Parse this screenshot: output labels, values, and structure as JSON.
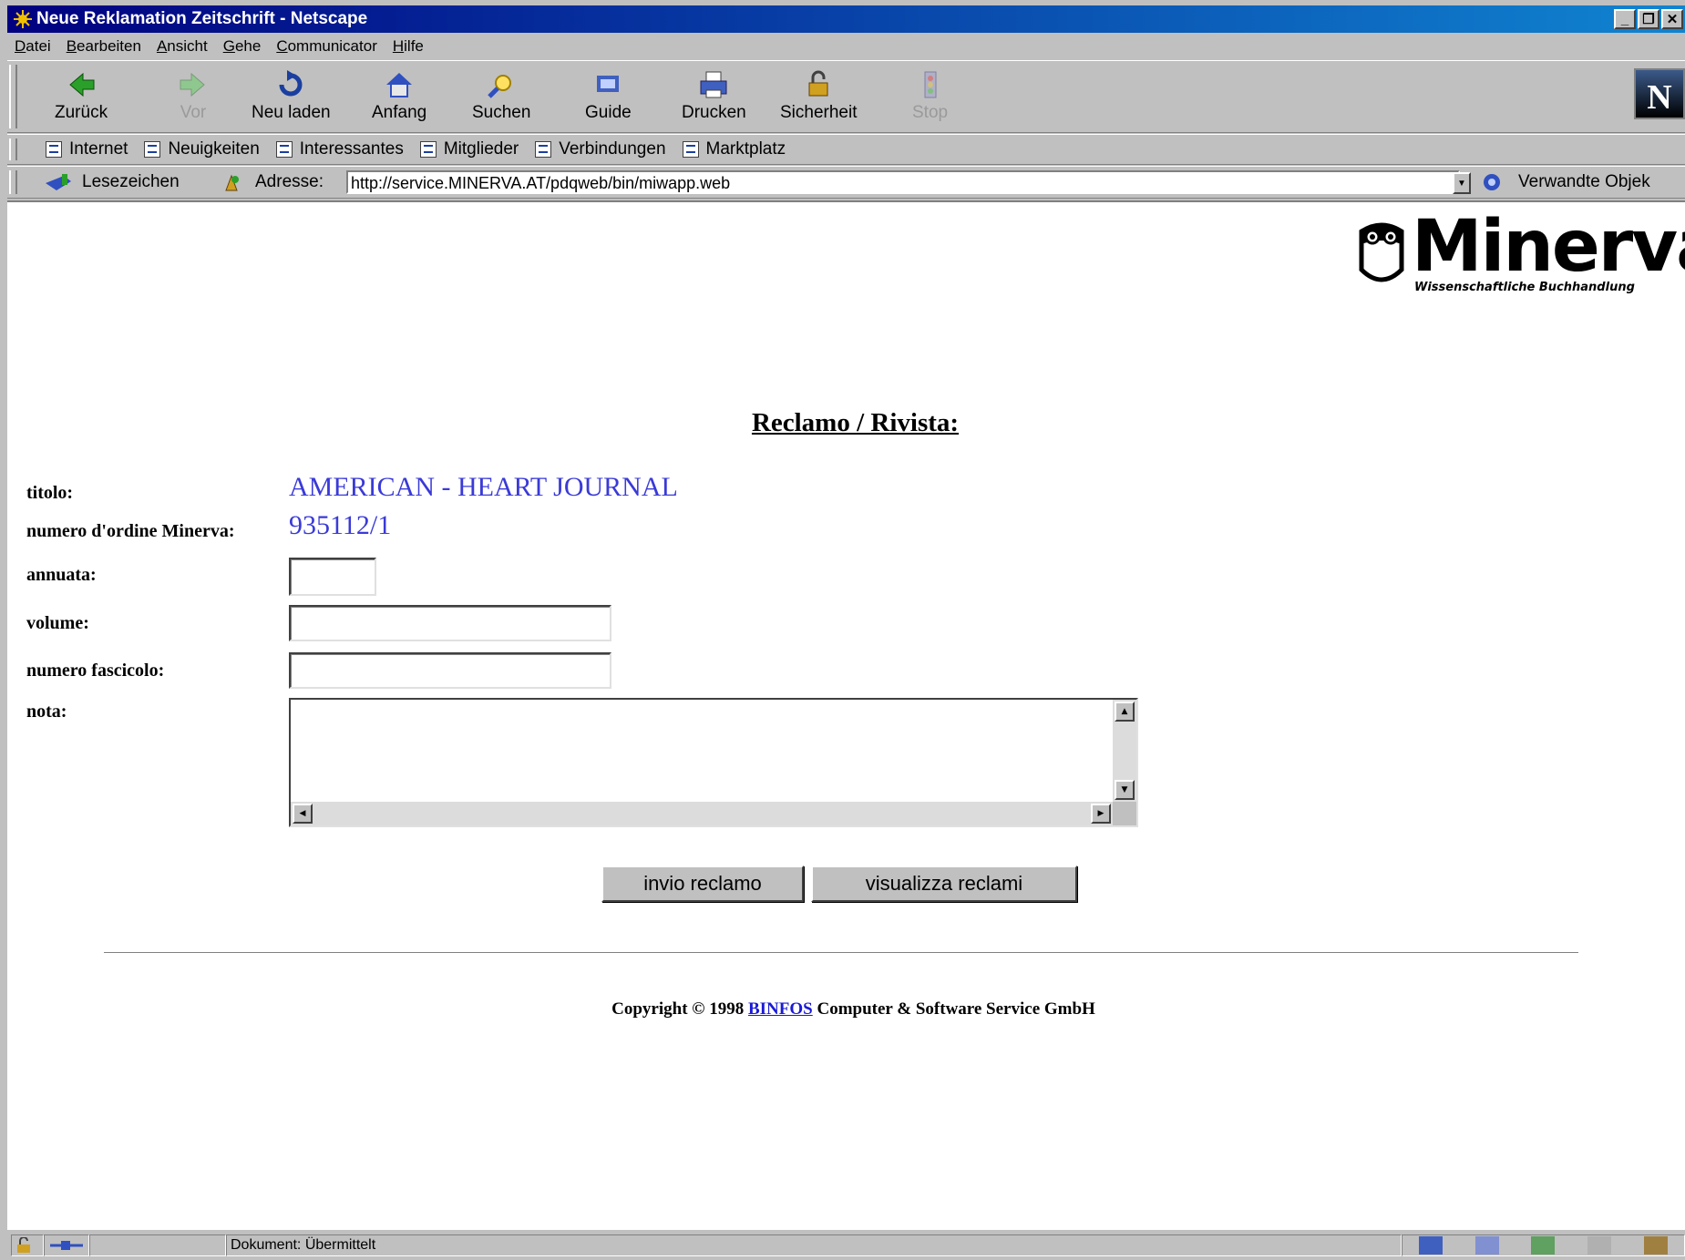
{
  "window": {
    "title": "Neue Reklamation Zeitschrift - Netscape"
  },
  "menu": [
    "Datei",
    "Bearbeiten",
    "Ansicht",
    "Gehe",
    "Communicator",
    "Hilfe"
  ],
  "nav_buttons": [
    {
      "label": "Zurück",
      "icon": "back-arrow-icon"
    },
    {
      "label": "Vor",
      "icon": "forward-arrow-icon"
    },
    {
      "label": "Neu laden",
      "icon": "reload-icon"
    },
    {
      "label": "Anfang",
      "icon": "home-icon"
    },
    {
      "label": "Suchen",
      "icon": "search-icon"
    },
    {
      "label": "Guide",
      "icon": "guide-icon"
    },
    {
      "label": "Drucken",
      "icon": "print-icon"
    },
    {
      "label": "Sicherheit",
      "icon": "security-lock-icon"
    },
    {
      "label": "Stop",
      "icon": "stop-icon"
    }
  ],
  "personal_bar": [
    "Internet",
    "Neuigkeiten",
    "Interessantes",
    "Mitglieder",
    "Verbindungen",
    "Marktplatz"
  ],
  "location": {
    "bookmarks_label": "Lesezeichen",
    "address_label": "Adresse:",
    "url": "http://service.MINERVA.AT/pdqweb/bin/miwapp.web",
    "related_label": "Verwandte Objek"
  },
  "logo": {
    "word": "Minerva",
    "tagline": "Wissenschaftliche Buchhandlung"
  },
  "page": {
    "heading": "Reclamo / Rivista:",
    "labels": {
      "titolo": "titolo:",
      "ordine": "numero d'ordine Minerva:",
      "annuata": "annuata:",
      "volume": "volume:",
      "fascicolo": "numero fascicolo:",
      "nota": "nota:"
    },
    "values": {
      "titolo": "AMERICAN - HEART JOURNAL",
      "ordine": "935112/1"
    },
    "fields": {
      "annuata": "",
      "volume": "",
      "fascicolo": "",
      "nota": ""
    },
    "buttons": {
      "submit": "invio reclamo",
      "view": "visualizza reclami"
    },
    "copyright_prefix": "Copyright © 1998",
    "copyright_link": "BINFOS",
    "copyright_suffix": "Computer & Software Service GmbH"
  },
  "status": {
    "text": "Dokument: Übermittelt"
  },
  "colors": {
    "titlebar": "#000080",
    "value_text": "#3a3ad8",
    "link": "#1a1ad8",
    "chrome": "#c0c0c0"
  }
}
